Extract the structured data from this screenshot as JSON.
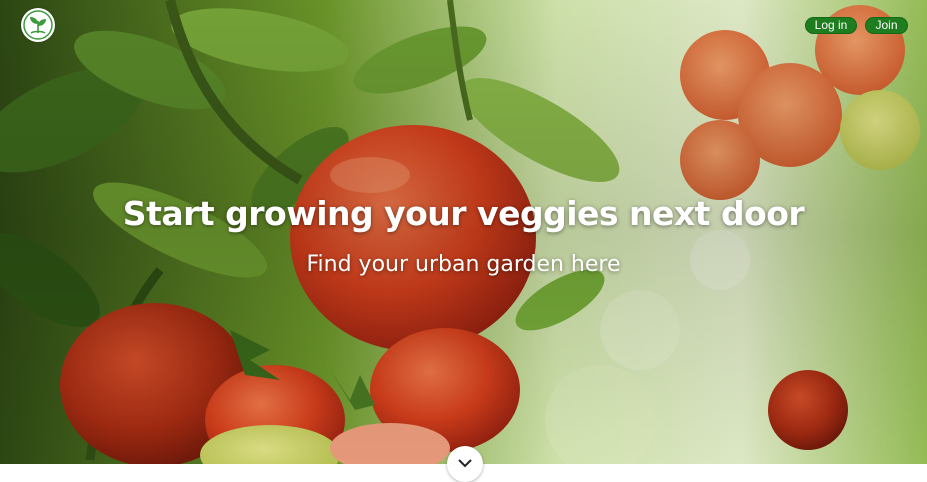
{
  "header": {
    "logo_icon": "leaf-seedling-icon",
    "nav": {
      "login_label": "Log in",
      "join_label": "Join"
    }
  },
  "hero": {
    "headline": "Start growing your veggies next door",
    "subheadline": "Find your urban garden here",
    "background_image": "tomato-plant-photo",
    "scroll_icon": "chevron-down-icon"
  },
  "colors": {
    "button_bg": "#1e7d1e",
    "button_text": "#ffffff",
    "logo_green": "#3c9a3c",
    "headline_text": "#ffffff"
  }
}
